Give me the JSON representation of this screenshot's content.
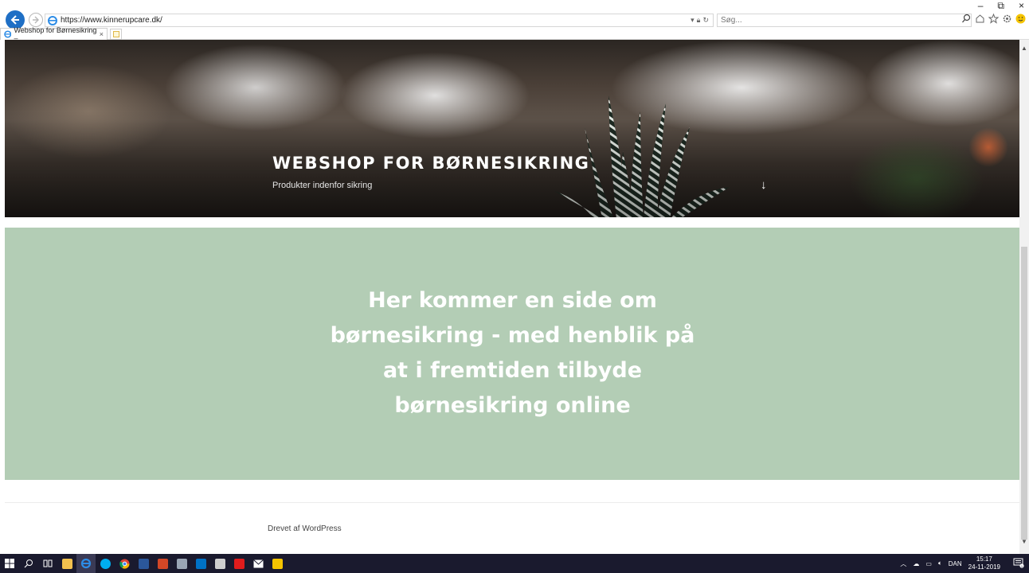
{
  "browser": {
    "url": "https://www.kinnerupcare.dk/",
    "search_placeholder": "Søg...",
    "tab_title": "Webshop for Børnesikring –...",
    "tab_close": "×"
  },
  "window_controls": {
    "minimize": "–",
    "restore": "⧉",
    "close": "×"
  },
  "hero": {
    "title": "WEBSHOP FOR BØRNESIKRING",
    "tagline": "Produkter indenfor sikring",
    "scroll_arrow": "↓"
  },
  "content": {
    "heading": "Her kommer en side om børnesikring - med henblik på at i fremtiden tilbyde børnesikring online"
  },
  "footer": {
    "credit": "Drevet af WordPress"
  },
  "taskbar": {
    "language": "DAN",
    "time": "15:17",
    "date": "24-11-2019",
    "notification_count": "1",
    "apps": [
      {
        "name": "start",
        "color": "#ffffff"
      },
      {
        "name": "search",
        "color": "#ffffff"
      },
      {
        "name": "task-view",
        "color": "#ffffff"
      },
      {
        "name": "file-explorer",
        "color": "#f2c14e"
      },
      {
        "name": "internet-explorer",
        "color": "#2d8ce6"
      },
      {
        "name": "skype",
        "color": "#00aff0"
      },
      {
        "name": "chrome",
        "color": "#e8b923"
      },
      {
        "name": "word",
        "color": "#2b579a"
      },
      {
        "name": "powerpoint",
        "color": "#d24726"
      },
      {
        "name": "outlook-app",
        "color": "#9aa6b5"
      },
      {
        "name": "outlook",
        "color": "#0072c6"
      },
      {
        "name": "calculator",
        "color": "#cfcfcf"
      },
      {
        "name": "acrobat",
        "color": "#e11c1c"
      },
      {
        "name": "mail",
        "color": "#ffffff"
      },
      {
        "name": "sticky",
        "color": "#f5c400"
      }
    ]
  },
  "colors": {
    "green_panel": "#b3cdb5",
    "ie_blue": "#1f6fc5"
  }
}
